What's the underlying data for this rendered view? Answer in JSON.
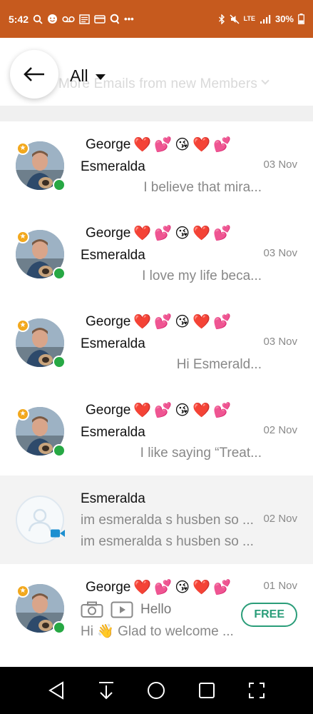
{
  "status_bar": {
    "time": "5:42",
    "battery": "30%",
    "network": "LTE",
    "left_icons": [
      "search-icon",
      "chat-icon",
      "voicemail-icon",
      "news-icon",
      "card-icon",
      "q-icon",
      "more-icon"
    ],
    "right_icons": [
      "bluetooth-icon",
      "mute-icon",
      "signal-icon",
      "battery-icon"
    ]
  },
  "header": {
    "filter_label": "All",
    "background_title": "More Emails from new Members"
  },
  "colors": {
    "status_bar": "#c65a1e",
    "online": "#27a844",
    "star_badge": "#f2a81d",
    "free_badge": "#2a9d79",
    "video_badge": "#1d8fd0"
  },
  "conversations": [
    {
      "sender": "George",
      "recipient": "Esmeralda",
      "date": "03 Nov",
      "snippet": "I believe that mira...",
      "online": true,
      "starred": true
    },
    {
      "sender": "George",
      "recipient": "Esmeralda",
      "date": "03 Nov",
      "snippet": "I love my life beca...",
      "online": true,
      "starred": true
    },
    {
      "sender": "George",
      "recipient": "Esmeralda",
      "date": "03 Nov",
      "snippet": "Hi Esmerald...",
      "online": true,
      "starred": true
    },
    {
      "sender": "George",
      "recipient": "Esmeralda",
      "date": "02 Nov",
      "snippet": "I like saying “Treat...",
      "online": true,
      "starred": true
    },
    {
      "recipient": "Esmeralda",
      "date": "02 Nov",
      "snippet_line1": "im esmeralda s husben so ...",
      "snippet_line2": "im esmeralda s husben so ...",
      "has_video": true
    },
    {
      "sender": "George",
      "date": "01 Nov",
      "media_caption": "Hello",
      "snippet": "Hi 👋 Glad to welcome ...",
      "badge": "FREE",
      "online": true,
      "starred": true
    }
  ],
  "name_emojis": [
    "❤️",
    "💕",
    "😘",
    "❤️",
    "💕"
  ],
  "nav_bar": [
    "back-nav-icon",
    "download-nav-icon",
    "home-nav-icon",
    "recents-nav-icon",
    "fullscreen-nav-icon"
  ]
}
